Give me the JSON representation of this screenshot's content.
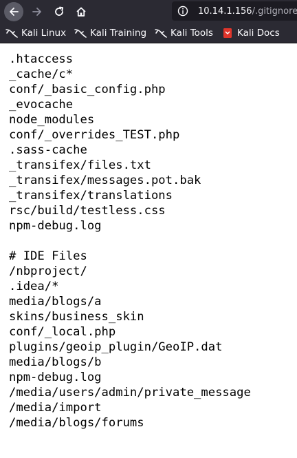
{
  "browser": {
    "url": {
      "host": "10.14.1.156",
      "path": "/.gitignore"
    },
    "bookmarks": [
      {
        "label": "Kali Linux",
        "icon": "kali-dragon-icon"
      },
      {
        "label": "Kali Training",
        "icon": "kali-dragon-icon"
      },
      {
        "label": "Kali Tools",
        "icon": "kali-dragon-icon"
      },
      {
        "label": "Kali Docs",
        "icon": "kali-docs-icon"
      }
    ],
    "colors": {
      "toolbar_bg": "#2b2a33",
      "urlbar_bg": "#1c1b22",
      "docs_icon": "#e0352b"
    }
  },
  "file": {
    "lines": [
      ".htaccess",
      "_cache/c*",
      "conf/_basic_config.php",
      "_evocache",
      "node_modules",
      "conf/_overrides_TEST.php",
      ".sass-cache",
      "_transifex/files.txt",
      "_transifex/messages.pot.bak",
      "_transifex/translations",
      "rsc/build/testless.css",
      "npm-debug.log",
      "",
      "# IDE Files",
      "/nbproject/",
      ".idea/*",
      "media/blogs/a",
      "skins/business_skin",
      "conf/_local.php",
      "plugins/geoip_plugin/GeoIP.dat",
      "media/blogs/b",
      "npm-debug.log",
      "/media/users/admin/private_message",
      "/media/import",
      "/media/blogs/forums"
    ]
  }
}
